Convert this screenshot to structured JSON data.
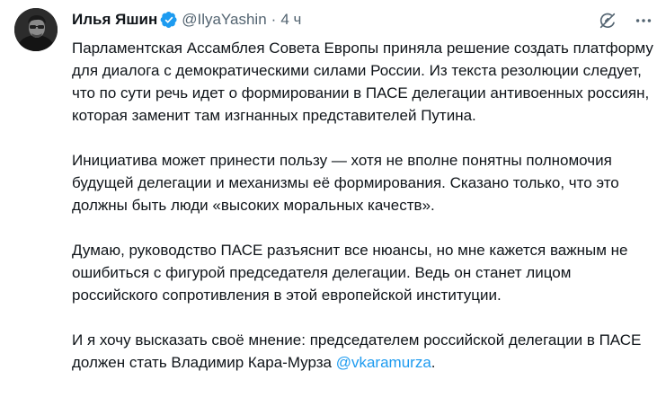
{
  "tweet": {
    "author_name": "Илья Яшин",
    "handle": "@IlyaYashin",
    "separator": "·",
    "time": "4 ч",
    "verified_icon": "verified-badge-icon",
    "colors": {
      "text": "#0f1419",
      "secondary": "#536471",
      "accent": "#1d9bf0"
    },
    "paragraphs": [
      "Парламентская Ассамблея Совета Европы приняла решение создать платформу для диалога с демократическими силами России. Из текста резолюции следует, что по сути речь идет о формировании в ПАСЕ делегации антивоенных россиян, которая заменит там изгнанных представителей Путина.",
      "Инициатива может принести пользу — хотя не вполне понятны полномочия будущей делегации и механизмы её формирования. Сказано только, что это должны быть люди «высоких моральных качеств».",
      "Думаю, руководство ПАСЕ разъяснит все нюансы, но мне кажется важным не ошибиться с фигурой председателя делегации. Ведь он станет лицом российского сопротивления в этой европейской институции."
    ],
    "last_paragraph_text": "И я хочу высказать своё мнение: председателем российской делегации в ПАСЕ должен стать Владимир Кара-Мурза ",
    "mention": "@vkaramurza",
    "last_paragraph_end": "."
  }
}
